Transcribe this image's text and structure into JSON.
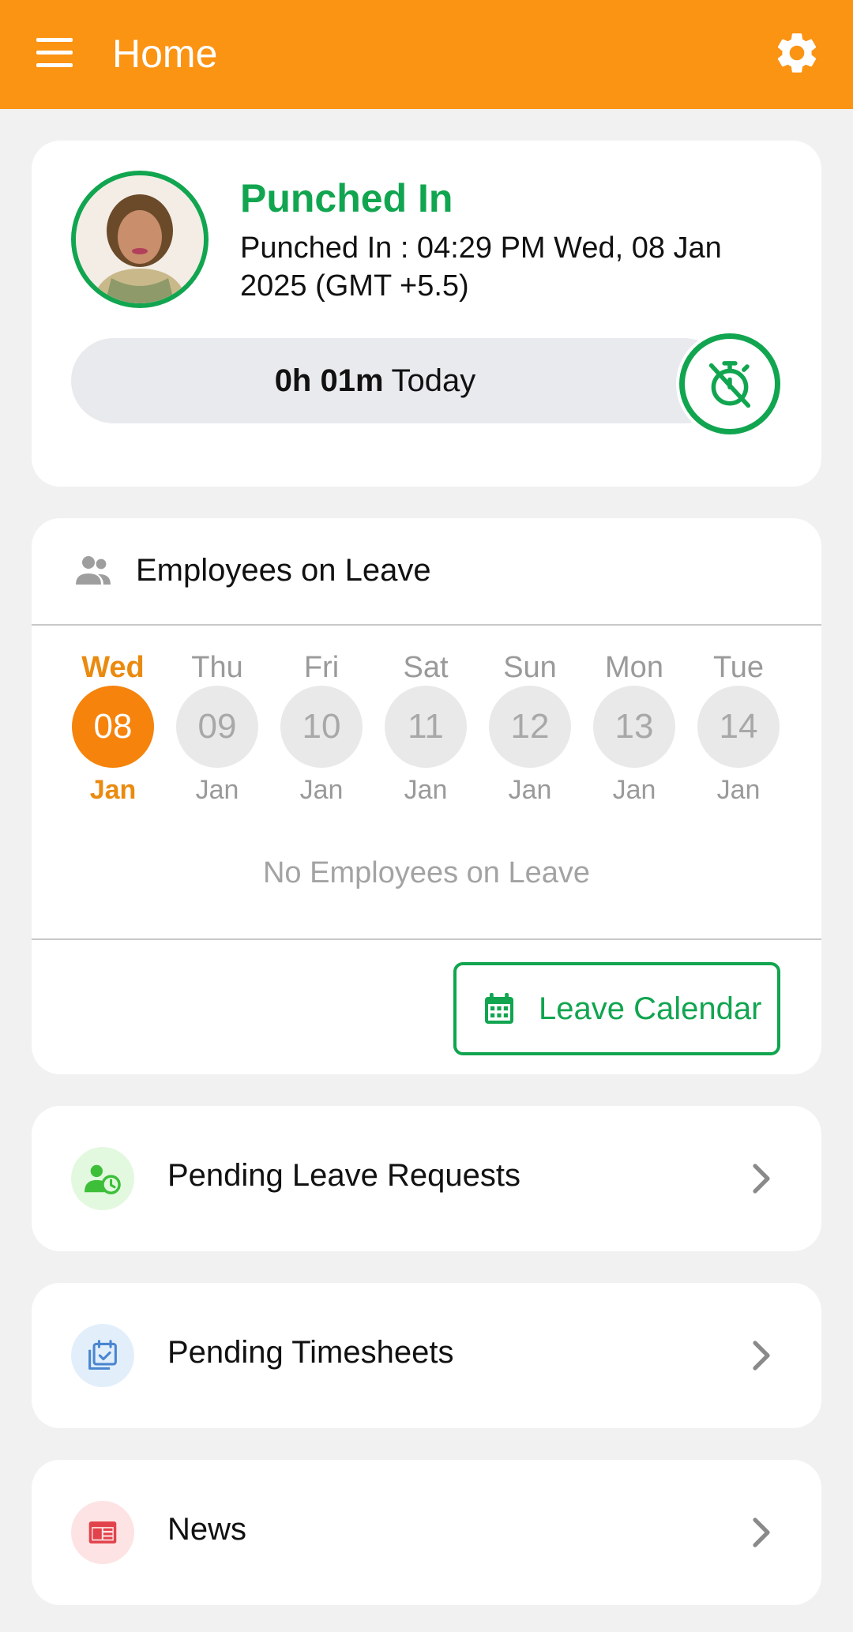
{
  "app_bar": {
    "title": "Home",
    "menu_icon": "hamburger-menu-icon",
    "settings_icon": "gear-icon",
    "color": "#fb9313"
  },
  "punch_card": {
    "status": "Punched In",
    "detail": "Punched In : 04:29 PM Wed, 08 Jan 2025 (GMT +5.5)",
    "duration": "0h 01m",
    "duration_suffix": "Today",
    "toggle_icon": "timer-off-icon",
    "accent": "#11a550"
  },
  "leave_card": {
    "title": "Employees on Leave",
    "days": [
      {
        "day": "Wed",
        "date": "08",
        "month": "Jan",
        "selected": true
      },
      {
        "day": "Thu",
        "date": "09",
        "month": "Jan",
        "selected": false
      },
      {
        "day": "Fri",
        "date": "10",
        "month": "Jan",
        "selected": false
      },
      {
        "day": "Sat",
        "date": "11",
        "month": "Jan",
        "selected": false
      },
      {
        "day": "Sun",
        "date": "12",
        "month": "Jan",
        "selected": false
      },
      {
        "day": "Mon",
        "date": "13",
        "month": "Jan",
        "selected": false
      },
      {
        "day": "Tue",
        "date": "14",
        "month": "Jan",
        "selected": false
      }
    ],
    "empty_text": "No Employees on Leave",
    "calendar_button": "Leave Calendar",
    "selected_color": "#f5830c"
  },
  "quick_links": [
    {
      "label": "Pending Leave Requests",
      "icon": "user-clock-icon"
    },
    {
      "label": "Pending Timesheets",
      "icon": "calendar-check-icon"
    },
    {
      "label": "News",
      "icon": "newspaper-icon"
    }
  ]
}
